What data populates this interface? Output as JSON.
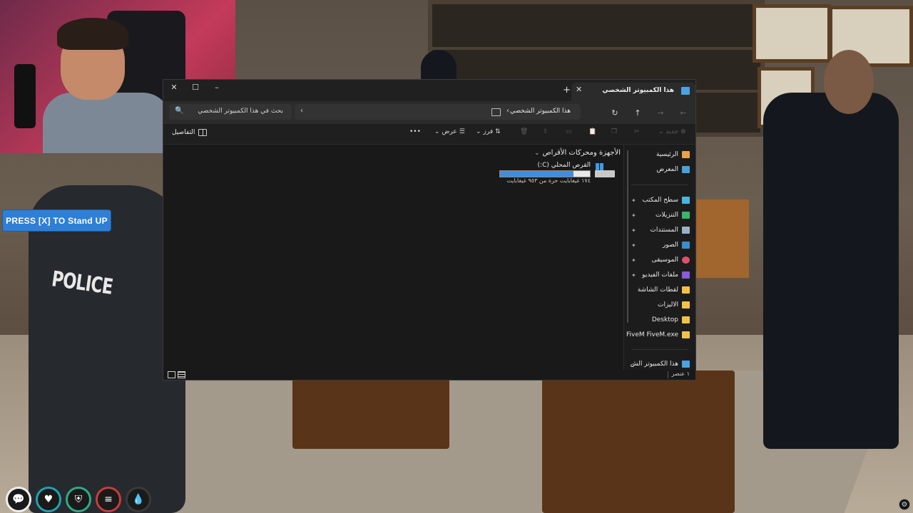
{
  "game_hud": {
    "prompt_label": "PRESS [X] TO Stand UP",
    "status_icons": [
      "chat-icon",
      "health-icon",
      "armor-icon",
      "hunger-icon",
      "thirst-icon"
    ]
  },
  "scene": {
    "vest_text": "POLICE"
  },
  "explorer": {
    "tab_title": "هذا الكمبيوتر الشخصي",
    "window_controls": {
      "minimize": "–",
      "maximize": "☐",
      "close": "✕"
    },
    "new_tab": "+",
    "tab_close": "✕",
    "address": {
      "chevron": "›",
      "crumb": "هذا الكمبيوتر الشخصي",
      "dropdown": "›"
    },
    "search_placeholder": "بحث في هذا الكمبيوتر الشخصي",
    "toolbar": {
      "new_label": "جديد",
      "sort_label": "فرز",
      "view_label": "عرض",
      "more": "•••",
      "details_label": "التفاصيل"
    },
    "nav": {
      "home": "الرئيسية",
      "gallery": "المعرض",
      "desktop_ar": "سطح المكتب",
      "downloads": "التنزيلات",
      "documents": "المستندات",
      "pictures": "الصور",
      "music": "الموسيقى",
      "videos": "ملفات الفيديو",
      "screenshots": "لقطات الشاشة",
      "files": "الاليزات",
      "desktop_en": "Desktop",
      "fivem": "FiveM FiveM.exe",
      "this_pc": "هذا الكمبيوتر الش"
    },
    "group_header": "الأجهزة ومحركات الأقراص",
    "drive": {
      "name": "القرص المحلي (C:)",
      "space": "١٧٤ غيغابايت حرة من ٩٥٣ غيغابايت",
      "used_fraction": 0.82
    },
    "status_count": "١ عنصر",
    "colors": {
      "accent": "#3d8fe0",
      "background": "#191919",
      "button": "#2f7fd4"
    }
  }
}
